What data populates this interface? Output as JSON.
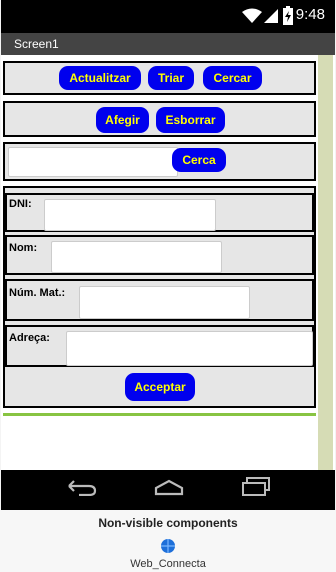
{
  "status_bar": {
    "time": "9:48"
  },
  "screen": {
    "title": "Screen1"
  },
  "row1": {
    "refresh_label": "Actualitzar",
    "sort_label": "Triar",
    "search_label": "Cercar"
  },
  "row2": {
    "add_label": "Afegir",
    "delete_label": "Esborrar"
  },
  "search_row": {
    "button_label": "Cerca",
    "input_value": ""
  },
  "form": {
    "dni_label": "DNI:",
    "name_label": "Nom:",
    "mat_label": "Núm. Mat.:",
    "address_label": "Adreça:",
    "dni_value": "",
    "name_value": "",
    "mat_value": "",
    "address_value": "",
    "accept_label": "Acceptar"
  },
  "non_visible": {
    "title": "Non-visible components",
    "component_name": "Web_Connecta"
  },
  "colors": {
    "button_bg": "#0000ee",
    "button_text": "#ffff00",
    "accent_line": "#88c442",
    "side_strip": "#d6dcb5"
  }
}
